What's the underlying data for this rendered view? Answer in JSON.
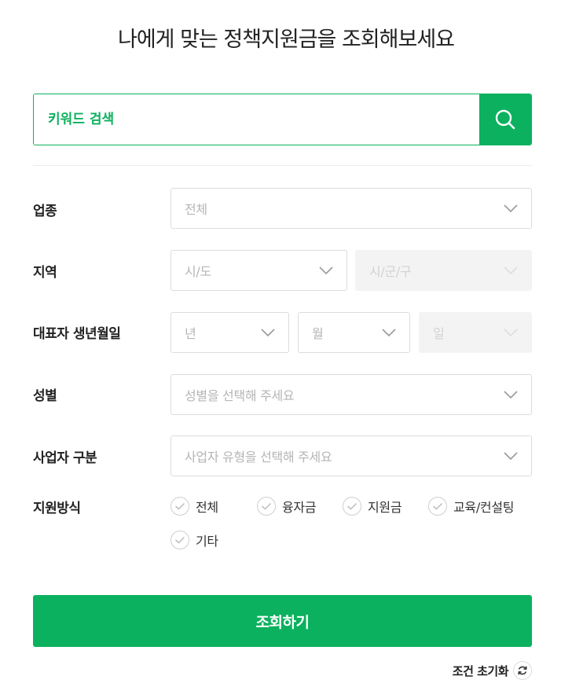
{
  "page": {
    "title": "나에게 맞는 정책지원금을 조회해보세요"
  },
  "search": {
    "placeholder": "키워드 검색"
  },
  "filters": {
    "industry": {
      "label": "업종",
      "value": "전체"
    },
    "region": {
      "label": "지역",
      "province": "시/도",
      "district": "시/군/구"
    },
    "birth": {
      "label": "대표자 생년월일",
      "year": "년",
      "month": "월",
      "day": "일"
    },
    "gender": {
      "label": "성별",
      "value": "성별을 선택해 주세요"
    },
    "business_type": {
      "label": "사업자 구분",
      "value": "사업자 유형을 선택해 주세요"
    },
    "support": {
      "label": "지원방식",
      "options": [
        "전체",
        "융자금",
        "지원금",
        "교육/컨설팅",
        "기타"
      ]
    }
  },
  "actions": {
    "submit": "조회하기",
    "reset": "조건 초기화"
  },
  "colors": {
    "accent": "#0bb15e"
  }
}
